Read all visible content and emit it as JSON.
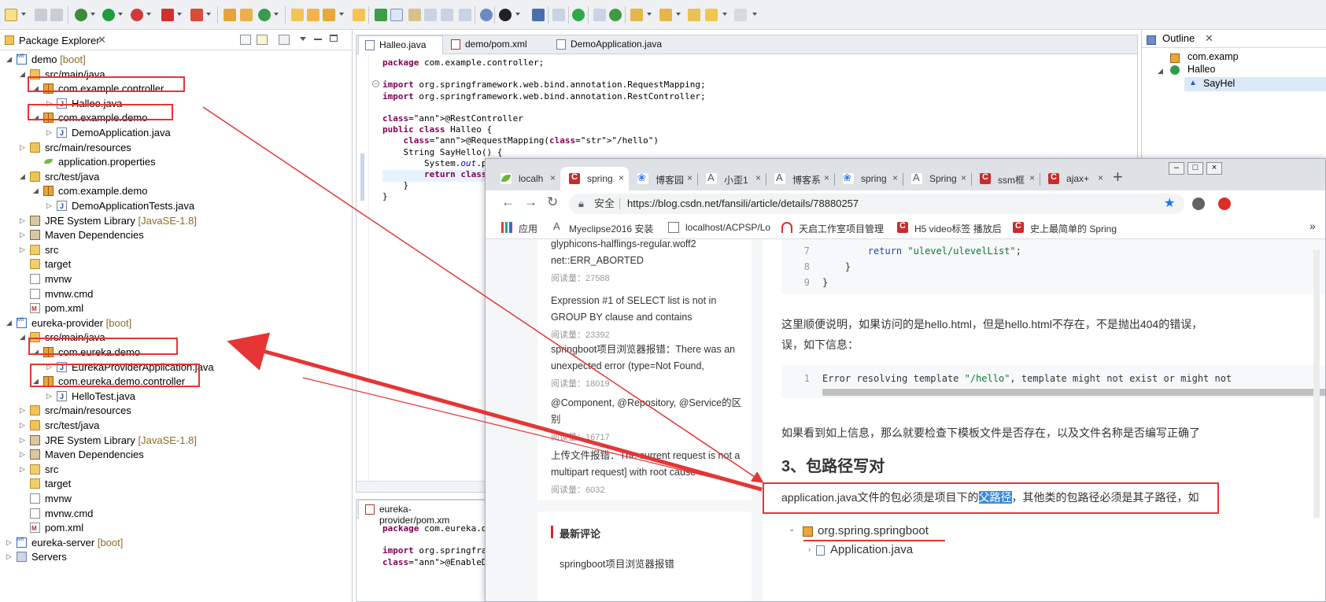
{
  "ide": {
    "package_explorer": {
      "title": "Package Explorer",
      "tree": [
        {
          "label": "demo",
          "deco": "[boot]",
          "icon": "project",
          "depth": 0
        },
        {
          "label": "src/main/java",
          "icon": "source-folder",
          "depth": 1
        },
        {
          "label": "com.example.controller",
          "icon": "package",
          "depth": 2
        },
        {
          "label": "Halleo.java",
          "icon": "java-file",
          "depth": 3
        },
        {
          "label": "com.example.demo",
          "icon": "package",
          "depth": 2
        },
        {
          "label": "DemoApplication.java",
          "icon": "java-file",
          "depth": 3
        },
        {
          "label": "src/main/resources",
          "icon": "source-folder",
          "depth": 1
        },
        {
          "label": "application.properties",
          "icon": "properties-file",
          "depth": 2
        },
        {
          "label": "src/test/java",
          "icon": "source-folder",
          "depth": 1
        },
        {
          "label": "com.example.demo",
          "icon": "package",
          "depth": 2
        },
        {
          "label": "DemoApplicationTests.java",
          "icon": "java-file",
          "depth": 3
        },
        {
          "label": "JRE System Library",
          "deco": "[JavaSE-1.8]",
          "icon": "library",
          "depth": 1
        },
        {
          "label": "Maven Dependencies",
          "icon": "library",
          "depth": 1
        },
        {
          "label": "src",
          "icon": "folder",
          "depth": 1
        },
        {
          "label": "target",
          "icon": "folder",
          "depth": 1
        },
        {
          "label": "mvnw",
          "icon": "file",
          "depth": 1
        },
        {
          "label": "mvnw.cmd",
          "icon": "file",
          "depth": 1
        },
        {
          "label": "pom.xml",
          "icon": "xml-file",
          "depth": 1
        },
        {
          "label": "eureka-provider",
          "deco": "[boot]",
          "icon": "project",
          "depth": 0
        },
        {
          "label": "src/main/java",
          "icon": "source-folder",
          "depth": 1
        },
        {
          "label": "com.eureka.demo",
          "icon": "package",
          "depth": 2
        },
        {
          "label": "EurekaProviderApplication.java",
          "icon": "java-file",
          "depth": 3
        },
        {
          "label": "com.eureka.demo.controller",
          "icon": "package",
          "depth": 2
        },
        {
          "label": "HelloTest.java",
          "icon": "java-file",
          "depth": 3
        },
        {
          "label": "src/main/resources",
          "icon": "source-folder",
          "depth": 1
        },
        {
          "label": "src/test/java",
          "icon": "source-folder",
          "depth": 1
        },
        {
          "label": "JRE System Library",
          "deco": "[JavaSE-1.8]",
          "icon": "library",
          "depth": 1
        },
        {
          "label": "Maven Dependencies",
          "icon": "library",
          "depth": 1
        },
        {
          "label": "src",
          "icon": "folder",
          "depth": 1
        },
        {
          "label": "target",
          "icon": "folder",
          "depth": 1
        },
        {
          "label": "mvnw",
          "icon": "file",
          "depth": 1
        },
        {
          "label": "mvnw.cmd",
          "icon": "file",
          "depth": 1
        },
        {
          "label": "pom.xml",
          "icon": "xml-file",
          "depth": 1
        },
        {
          "label": "eureka-server",
          "deco": "[boot]",
          "icon": "project",
          "depth": 0
        },
        {
          "label": "Servers",
          "icon": "servers",
          "depth": 0
        }
      ]
    },
    "editor": {
      "tabs": [
        {
          "label": "Halleo.java",
          "active": true
        },
        {
          "label": "demo/pom.xml",
          "active": false
        },
        {
          "label": "DemoApplication.java",
          "active": false
        }
      ],
      "code": [
        "package com.example.controller;",
        "",
        "import org.springframework.web.bind.annotation.RequestMapping;",
        "import org.springframework.web.bind.annotation.RestController;",
        "",
        "@RestController",
        "public class Halleo {",
        "    @RequestMapping(\"/hello\")",
        "    String SayHello() {",
        "        System.out.p",
        "        return \"Hell",
        "    }",
        "}"
      ]
    },
    "editor2": {
      "tab": "eureka-provider/pom.xm",
      "code": [
        "package com.eureka.d",
        "",
        "import org.springfra",
        "@EnableDiscoveryCli"
      ]
    },
    "outline": {
      "title": "Outline",
      "items": [
        "com.examp",
        "Halleo",
        "SayHel"
      ]
    }
  },
  "browser": {
    "tabs": [
      {
        "label": "localh",
        "icon": "leaf"
      },
      {
        "label": "spring",
        "icon": "csdn",
        "active": true
      },
      {
        "label": "博客园",
        "icon": "paw"
      },
      {
        "label": "小歪1",
        "icon": "a"
      },
      {
        "label": "博客系",
        "icon": "a"
      },
      {
        "label": "spring",
        "icon": "paw"
      },
      {
        "label": "Spring",
        "icon": "a"
      },
      {
        "label": "ssm框",
        "icon": "csdn"
      },
      {
        "label": "ajax+",
        "icon": "csdn"
      }
    ],
    "security_label": "安全",
    "url": "https://blog.csdn.net/fansili/article/details/78880257",
    "bookmarks": [
      {
        "label": "应用"
      },
      {
        "label": "Myeclipse2016 安装"
      },
      {
        "label": "localhost/ACPSP/Lo"
      },
      {
        "label": "天启工作室项目管理"
      },
      {
        "label": "H5 video标签 播放后"
      },
      {
        "label": "史上最简单的 Spring"
      }
    ],
    "bookmarks_more": "»",
    "sidebar": {
      "articles": [
        {
          "title": "glyphicons-halflings-regular.woff2 net::ERR_ABORTED",
          "reads": "阅读量：27588"
        },
        {
          "title": "Expression #1 of SELECT list is not in GROUP BY clause and contains",
          "reads": "阅读量：23392"
        },
        {
          "title": "springboot项目浏览器报错：There was an unexpected error (type=Not Found,",
          "reads": "阅读量：18019"
        },
        {
          "title": "@Component, @Repository, @Service的区别",
          "reads": "阅读量：16717"
        },
        {
          "title": "上传文件报错：The current request is not a multipart request] with root cause",
          "reads": "阅读量：6032"
        }
      ],
      "section_title": "最新评论",
      "trailing": "springboot项目浏览器报错"
    },
    "article": {
      "code1": [
        {
          "n": "7",
          "text": "        return \"ulevel/ulevelList\";"
        },
        {
          "n": "8",
          "text": "    }"
        },
        {
          "n": "9",
          "text": "}"
        }
      ],
      "para1_line1": "这里顺便说明，如果访问的是hello.html，但是hello.html不存在，不是抛出404的错误，",
      "para1_line2": "误，如下信息：",
      "code2": {
        "n": "1",
        "text": "Error resolving template \"/hello\", template might not exist or might not"
      },
      "para2": "如果看到如上信息，那么就要检查下模板文件是否存在，以及文件名称是否编写正确了",
      "heading": "3、包路径写对",
      "para3_before": "application.java文件的包必须是项目下的",
      "para3_highlight": "父路径",
      "para3_after": "，其他类的包路径必须是其子路径，如",
      "tree": [
        "org.spring.springboot",
        "Application.java"
      ]
    }
  },
  "colors": {
    "annotation_red": "#e53535",
    "csdn_red": "#c92c2c"
  }
}
